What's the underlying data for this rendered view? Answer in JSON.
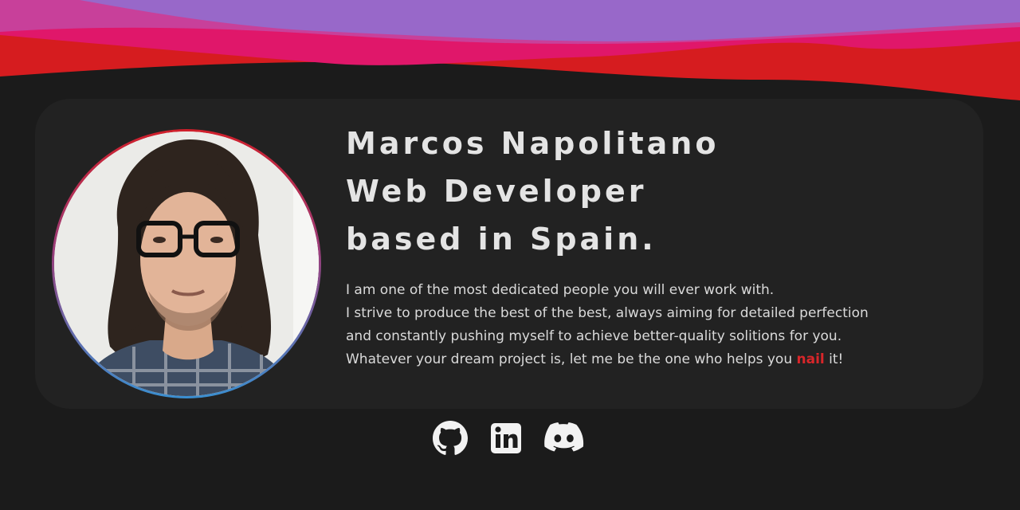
{
  "profile": {
    "heading_lines": [
      "Marcos Napolitano",
      "Web Developer",
      "based in Spain."
    ],
    "bio_lines": [
      "I am one of the most dedicated people you will ever work with.",
      "I strive to produce the best of the best, always aiming for detailed perfection",
      "and constantly pushing myself to achieve better-quality solitions for you."
    ],
    "bio_last_line": {
      "before": "Whatever your dream project is, let me be the one who helps you ",
      "highlight": "nail",
      "after": " it!"
    }
  },
  "social_links": [
    {
      "name": "github",
      "icon": "github-icon"
    },
    {
      "name": "linkedin",
      "icon": "linkedin-icon"
    },
    {
      "name": "discord",
      "icon": "discord-icon"
    }
  ],
  "colors": {
    "background": "#1b1b1b",
    "card": "#222222",
    "accent": "#d8262a",
    "wave_purple": "#9868c9",
    "wave_pink": "#e0176a",
    "wave_red": "#d61c1f"
  }
}
